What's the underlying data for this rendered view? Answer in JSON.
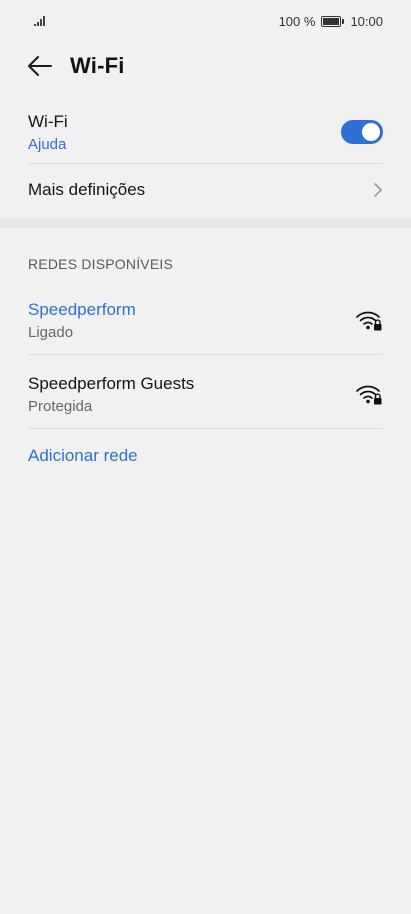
{
  "status_bar": {
    "battery_percent": "100 %",
    "time": "10:00",
    "signal_icon": "signal-bars-icon",
    "battery_icon": "battery-icon"
  },
  "header": {
    "back_icon": "arrow-left-icon",
    "title": "Wi-Fi"
  },
  "wifi_toggle_row": {
    "label": "Wi-Fi",
    "help_link": "Ajuda",
    "toggle_on": true,
    "toggle_color": "#2f6fd6"
  },
  "more_settings": {
    "label": "Mais definições",
    "chevron_icon": "chevron-right-icon"
  },
  "available_networks": {
    "section_title": "REDES DISPONÍVEIS",
    "networks": [
      {
        "name": "Speedperform",
        "status": "Ligado",
        "connected": true,
        "icon": "wifi-locked-icon"
      },
      {
        "name": "Speedperform Guests",
        "status": "Protegida",
        "connected": false,
        "icon": "wifi-locked-icon"
      }
    ],
    "add_network_label": "Adicionar rede"
  },
  "colors": {
    "accent": "#2f6fd6",
    "background": "#f1f1f1"
  }
}
